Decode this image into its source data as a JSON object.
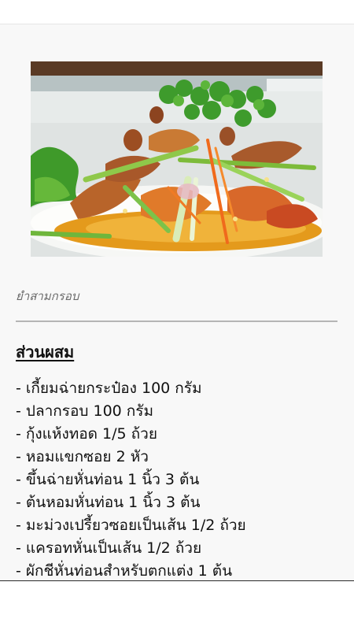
{
  "dish": {
    "image_alt": "ยำสามกรอบ",
    "caption": "ยำสามกรอบ"
  },
  "ingredients_section": {
    "title": "ส่วนผสม",
    "items": [
      "- เกี้ยมฉ่ายกระป๋อง 100 กรัม",
      "- ปลากรอบ 100 กรัม",
      "- กุ้งแห้งทอด 1/5 ถ้วย",
      "- หอมแขกซอย 2 หัว",
      "- ขึ้นฉ่ายหั่นท่อน 1 นิ้ว 3 ต้น",
      "- ต้นหอมหั่นท่อน 1 นิ้ว 3 ต้น",
      "- มะม่วงเปรี้ยวซอยเป็นเส้น 1/2 ถ้วย",
      "- แครอทหั่นเป็นเส้น 1/2 ถ้วย",
      "- ผักชีหั่นท่อนสำหรับตกแต่ง 1 ต้น"
    ]
  },
  "colors": {
    "background": "#f8f8f8",
    "text": "#111111",
    "caption": "#6a6a6a",
    "divider": "#b5b5b5"
  }
}
